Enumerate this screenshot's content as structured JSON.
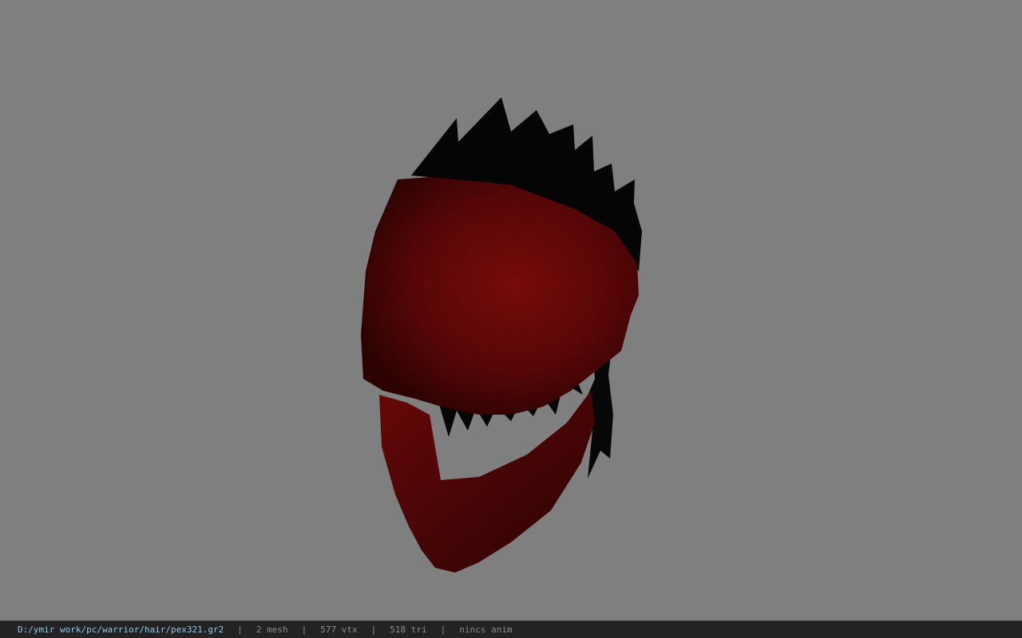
{
  "viewer": {
    "background_color": "#7f7f7f",
    "model": {
      "hair_color": "#050505",
      "bandana_color": "#7a0a0a"
    }
  },
  "statusbar": {
    "file_path": "D:/ymir work/pc/warrior/hair/pex321.gr2",
    "separator": "|",
    "mesh_count": "2 mesh",
    "vertex_count": "577 vtx",
    "triangle_count": "518 tri",
    "animation": "nincs anim",
    "path_color": "#8fc9e8",
    "text_color": "#8c8c8c"
  }
}
